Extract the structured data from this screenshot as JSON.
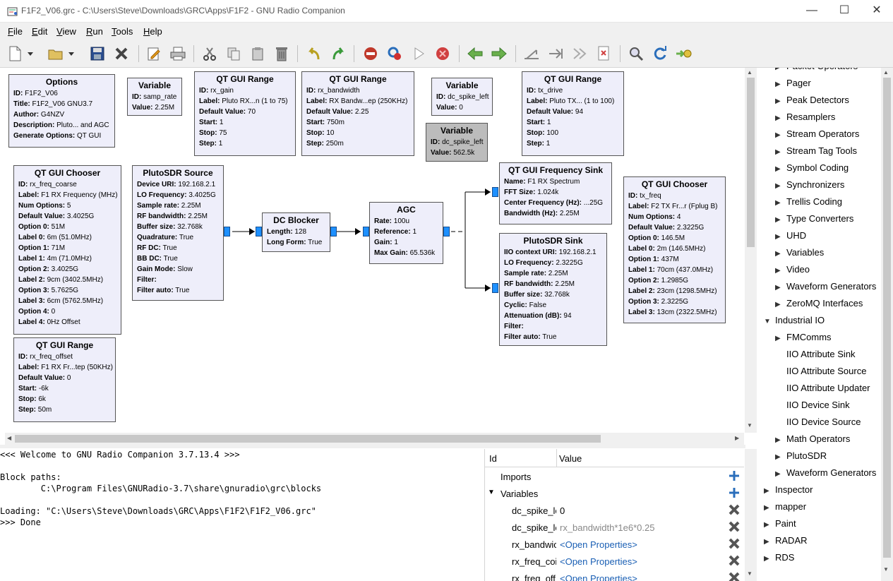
{
  "window": {
    "title": "F1F2_V06.grc - C:\\Users\\Steve\\Downloads\\GRC\\Apps\\F1F2 - GNU Radio Companion",
    "minimize": "—",
    "maximize": "☐",
    "close": "✕"
  },
  "menu": [
    "File",
    "Edit",
    "View",
    "Run",
    "Tools",
    "Help"
  ],
  "blocks": {
    "options": {
      "title": "Options",
      "lines": [
        [
          "ID:",
          "F1F2_V06"
        ],
        [
          "Title:",
          "F1F2_V06 GNU3.7"
        ],
        [
          "Author:",
          "G4NZV"
        ],
        [
          "Description:",
          "Pluto... and AGC"
        ],
        [
          "Generate Options:",
          "QT GUI"
        ]
      ]
    },
    "var_samp": {
      "title": "Variable",
      "lines": [
        [
          "ID:",
          "samp_rate"
        ],
        [
          "Value:",
          "2.25M"
        ]
      ]
    },
    "range_gain": {
      "title": "QT GUI Range",
      "lines": [
        [
          "ID:",
          "rx_gain"
        ],
        [
          "Label:",
          "Pluto RX...n (1 to 75)"
        ],
        [
          "Default Value:",
          "70"
        ],
        [
          "Start:",
          "1"
        ],
        [
          "Stop:",
          "75"
        ],
        [
          "Step:",
          "1"
        ]
      ]
    },
    "range_bw": {
      "title": "QT GUI Range",
      "lines": [
        [
          "ID:",
          "rx_bandwidth"
        ],
        [
          "Label:",
          "RX Bandw...ep (250KHz)"
        ],
        [
          "Default Value:",
          "2.25"
        ],
        [
          "Start:",
          "750m"
        ],
        [
          "Stop:",
          "10"
        ],
        [
          "Step:",
          "250m"
        ]
      ]
    },
    "var_dc1": {
      "title": "Variable",
      "lines": [
        [
          "ID:",
          "dc_spike_left"
        ],
        [
          "Value:",
          "0"
        ]
      ]
    },
    "var_dc2": {
      "title": "Variable",
      "lines": [
        [
          "ID:",
          "dc_spike_left"
        ],
        [
          "Value:",
          "562.5k"
        ]
      ]
    },
    "range_tx": {
      "title": "QT GUI Range",
      "lines": [
        [
          "ID:",
          "tx_drive"
        ],
        [
          "Label:",
          "Pluto TX... (1 to 100)"
        ],
        [
          "Default Value:",
          "94"
        ],
        [
          "Start:",
          "1"
        ],
        [
          "Stop:",
          "100"
        ],
        [
          "Step:",
          "1"
        ]
      ]
    },
    "chooser_rx": {
      "title": "QT GUI Chooser",
      "lines": [
        [
          "ID:",
          "rx_freq_coarse"
        ],
        [
          "Label:",
          "F1 RX Frequency (MHz)"
        ],
        [
          "Num Options:",
          "5"
        ],
        [
          "Default Value:",
          "3.4025G"
        ],
        [
          "Option 0:",
          "51M"
        ],
        [
          "Label 0:",
          "6m (51.0MHz)"
        ],
        [
          "Option 1:",
          "71M"
        ],
        [
          "Label 1:",
          "4m (71.0MHz)"
        ],
        [
          "Option 2:",
          "3.4025G"
        ],
        [
          "Label 2:",
          "9cm (3402.5MHz)"
        ],
        [
          "Option 3:",
          "5.7625G"
        ],
        [
          "Label 3:",
          "6cm (5762.5MHz)"
        ],
        [
          "Option 4:",
          "0"
        ],
        [
          "Label 4:",
          "0Hz Offset"
        ]
      ]
    },
    "pluto_src": {
      "title": "PlutoSDR Source",
      "lines": [
        [
          "Device URI:",
          "192.168.2.1"
        ],
        [
          "LO Frequency:",
          "3.4025G"
        ],
        [
          "Sample rate:",
          "2.25M"
        ],
        [
          "RF bandwidth:",
          "2.25M"
        ],
        [
          "Buffer size:",
          "32.768k"
        ],
        [
          "Quadrature:",
          "True"
        ],
        [
          "RF DC:",
          "True"
        ],
        [
          "BB DC:",
          "True"
        ],
        [
          "Gain Mode:",
          "Slow"
        ],
        [
          "Filter:",
          ""
        ],
        [
          "Filter auto:",
          "True"
        ]
      ]
    },
    "dc_blocker": {
      "title": "DC Blocker",
      "lines": [
        [
          "Length:",
          "128"
        ],
        [
          "Long Form:",
          "True"
        ]
      ]
    },
    "agc": {
      "title": "AGC",
      "lines": [
        [
          "Rate:",
          "100u"
        ],
        [
          "Reference:",
          "1"
        ],
        [
          "Gain:",
          "1"
        ],
        [
          "Max Gain:",
          "65.536k"
        ]
      ]
    },
    "freq_sink": {
      "title": "QT GUI Frequency Sink",
      "lines": [
        [
          "Name:",
          "F1 RX Spectrum"
        ],
        [
          "FFT Size:",
          "1.024k"
        ],
        [
          "Center Frequency (Hz):",
          "...25G"
        ],
        [
          "Bandwidth (Hz):",
          "2.25M"
        ]
      ]
    },
    "pluto_sink": {
      "title": "PlutoSDR Sink",
      "lines": [
        [
          "IIO context URI:",
          "192.168.2.1"
        ],
        [
          "LO Frequency:",
          "2.3225G"
        ],
        [
          "Sample rate:",
          "2.25M"
        ],
        [
          "RF bandwidth:",
          "2.25M"
        ],
        [
          "Buffer size:",
          "32.768k"
        ],
        [
          "Cyclic:",
          "False"
        ],
        [
          "Attenuation (dB):",
          "94"
        ],
        [
          "Filter:",
          ""
        ],
        [
          "Filter auto:",
          "True"
        ]
      ]
    },
    "chooser_tx": {
      "title": "QT GUI Chooser",
      "lines": [
        [
          "ID:",
          "tx_freq"
        ],
        [
          "Label:",
          "F2 TX Fr...r (Fplug B)"
        ],
        [
          "Num Options:",
          "4"
        ],
        [
          "Default Value:",
          "2.3225G"
        ],
        [
          "Option 0:",
          "146.5M"
        ],
        [
          "Label 0:",
          "2m (146.5MHz)"
        ],
        [
          "Option 1:",
          "437M"
        ],
        [
          "Label 1:",
          "70cm (437.0MHz)"
        ],
        [
          "Option 2:",
          "1.2985G"
        ],
        [
          "Label 2:",
          "23cm (1298.5MHz)"
        ],
        [
          "Option 3:",
          "2.3225G"
        ],
        [
          "Label 3:",
          "13cm (2322.5MHz)"
        ]
      ]
    },
    "range_offset": {
      "title": "QT GUI Range",
      "lines": [
        [
          "ID:",
          "rx_freq_offset"
        ],
        [
          "Label:",
          "F1 RX Fr...tep (50KHz)"
        ],
        [
          "Default Value:",
          "0"
        ],
        [
          "Start:",
          "-6k"
        ],
        [
          "Stop:",
          "6k"
        ],
        [
          "Step:",
          "50m"
        ]
      ]
    }
  },
  "console": [
    "<<< Welcome to GNU Radio Companion 3.7.13.4 >>>",
    "",
    "Block paths:",
    "        C:\\Program Files\\GNURadio-3.7\\share\\gnuradio\\grc\\blocks",
    "",
    "Loading: \"C:\\Users\\Steve\\Downloads\\GRC\\Apps\\F1F2\\F1F2_V06.grc\"",
    ">>> Done"
  ],
  "vars_panel": {
    "col_id": "Id",
    "col_value": "Value",
    "rows": [
      {
        "id": "Imports",
        "value": "",
        "indent": 0,
        "arrow": "",
        "action": "add"
      },
      {
        "id": "Variables",
        "value": "",
        "indent": 0,
        "arrow": "▼",
        "action": "add"
      },
      {
        "id": "dc_spike_le",
        "value": "0",
        "indent": 1,
        "arrow": "",
        "action": "remove",
        "style": "normal"
      },
      {
        "id": "dc_spike_le",
        "value": "rx_bandwidth*1e6*0.25",
        "indent": 1,
        "arrow": "",
        "action": "remove",
        "style": "grey"
      },
      {
        "id": "rx_bandwic",
        "value": "<Open Properties>",
        "indent": 1,
        "arrow": "",
        "action": "remove",
        "style": "link"
      },
      {
        "id": "rx_freq_coi",
        "value": "<Open Properties>",
        "indent": 1,
        "arrow": "",
        "action": "remove",
        "style": "link"
      },
      {
        "id": "rx_freq_off",
        "value": "<Open Properties>",
        "indent": 1,
        "arrow": "",
        "action": "remove",
        "style": "link"
      }
    ]
  },
  "tree": [
    {
      "label": "Packet Operators",
      "level": 1,
      "arrow": "▶"
    },
    {
      "label": "Pager",
      "level": 1,
      "arrow": "▶"
    },
    {
      "label": "Peak Detectors",
      "level": 1,
      "arrow": "▶"
    },
    {
      "label": "Resamplers",
      "level": 1,
      "arrow": "▶"
    },
    {
      "label": "Stream Operators",
      "level": 1,
      "arrow": "▶"
    },
    {
      "label": "Stream Tag Tools",
      "level": 1,
      "arrow": "▶"
    },
    {
      "label": "Symbol Coding",
      "level": 1,
      "arrow": "▶"
    },
    {
      "label": "Synchronizers",
      "level": 1,
      "arrow": "▶"
    },
    {
      "label": "Trellis Coding",
      "level": 1,
      "arrow": "▶"
    },
    {
      "label": "Type Converters",
      "level": 1,
      "arrow": "▶"
    },
    {
      "label": "UHD",
      "level": 1,
      "arrow": "▶"
    },
    {
      "label": "Variables",
      "level": 1,
      "arrow": "▶"
    },
    {
      "label": "Video",
      "level": 1,
      "arrow": "▶"
    },
    {
      "label": "Waveform Generators",
      "level": 1,
      "arrow": "▶"
    },
    {
      "label": "ZeroMQ Interfaces",
      "level": 1,
      "arrow": "▶"
    },
    {
      "label": "Industrial IO",
      "level": 0,
      "arrow": "▼"
    },
    {
      "label": "FMComms",
      "level": 1,
      "arrow": "▶"
    },
    {
      "label": "IIO Attribute Sink",
      "level": 1,
      "arrow": ""
    },
    {
      "label": "IIO Attribute Source",
      "level": 1,
      "arrow": ""
    },
    {
      "label": "IIO Attribute Updater",
      "level": 1,
      "arrow": ""
    },
    {
      "label": "IIO Device Sink",
      "level": 1,
      "arrow": ""
    },
    {
      "label": "IIO Device Source",
      "level": 1,
      "arrow": ""
    },
    {
      "label": "Math Operators",
      "level": 1,
      "arrow": "▶"
    },
    {
      "label": "PlutoSDR",
      "level": 1,
      "arrow": "▶"
    },
    {
      "label": "Waveform Generators",
      "level": 1,
      "arrow": "▶"
    },
    {
      "label": "Inspector",
      "level": 0,
      "arrow": "▶"
    },
    {
      "label": "mapper",
      "level": 0,
      "arrow": "▶"
    },
    {
      "label": "Paint",
      "level": 0,
      "arrow": "▶"
    },
    {
      "label": "RADAR",
      "level": 0,
      "arrow": "▶"
    },
    {
      "label": "RDS",
      "level": 0,
      "arrow": "▶"
    }
  ],
  "colors": {
    "port": "#1e90ff",
    "block": "#eeeefa",
    "disabled_block": "#bcbcbc",
    "link": "#1a5fb4"
  }
}
